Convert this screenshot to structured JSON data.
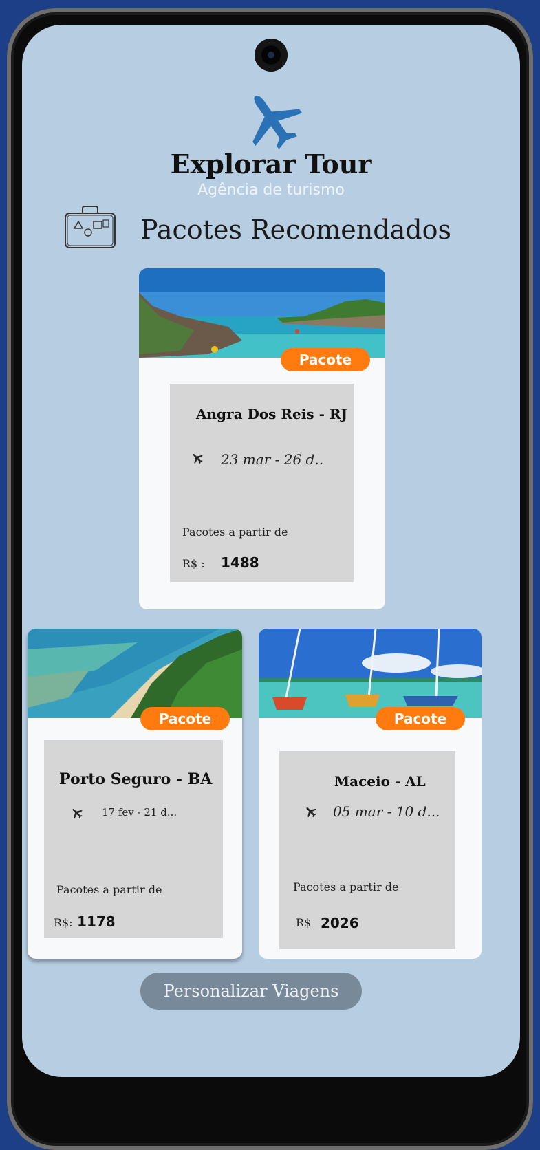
{
  "brand": {
    "title": "Explorar Tour",
    "subtitle": "Agência de turismo"
  },
  "section": {
    "title": "Pacotes Recomendados"
  },
  "packages": [
    {
      "badge": "Pacote",
      "destination": "Angra Dos Reis - RJ",
      "dates": "23 mar - 26 d..",
      "from_label": "Pacotes a partir  de",
      "currency": "R$ :",
      "price": "1488"
    },
    {
      "badge": "Pacote",
      "destination": "Porto Seguro - BA",
      "dates": "17 fev - 21 d...",
      "from_label": "Pacotes a partir de",
      "currency": "R$:",
      "price": "1178"
    },
    {
      "badge": "Pacote",
      "destination": "Maceio  - AL",
      "dates": "05 mar - 10 d...",
      "from_label": "Pacotes a partir de",
      "currency": "R$",
      "price": "2026"
    }
  ],
  "cta": {
    "label": "Personalizar Viagens"
  },
  "icons": {
    "logo": "airplane-icon",
    "section": "suitcase-icon",
    "date": "airplane-icon"
  },
  "colors": {
    "accent": "#ff7b10",
    "screen_bg": "#b7cde2",
    "logo": "#2a72b5",
    "button": "#78899a"
  }
}
